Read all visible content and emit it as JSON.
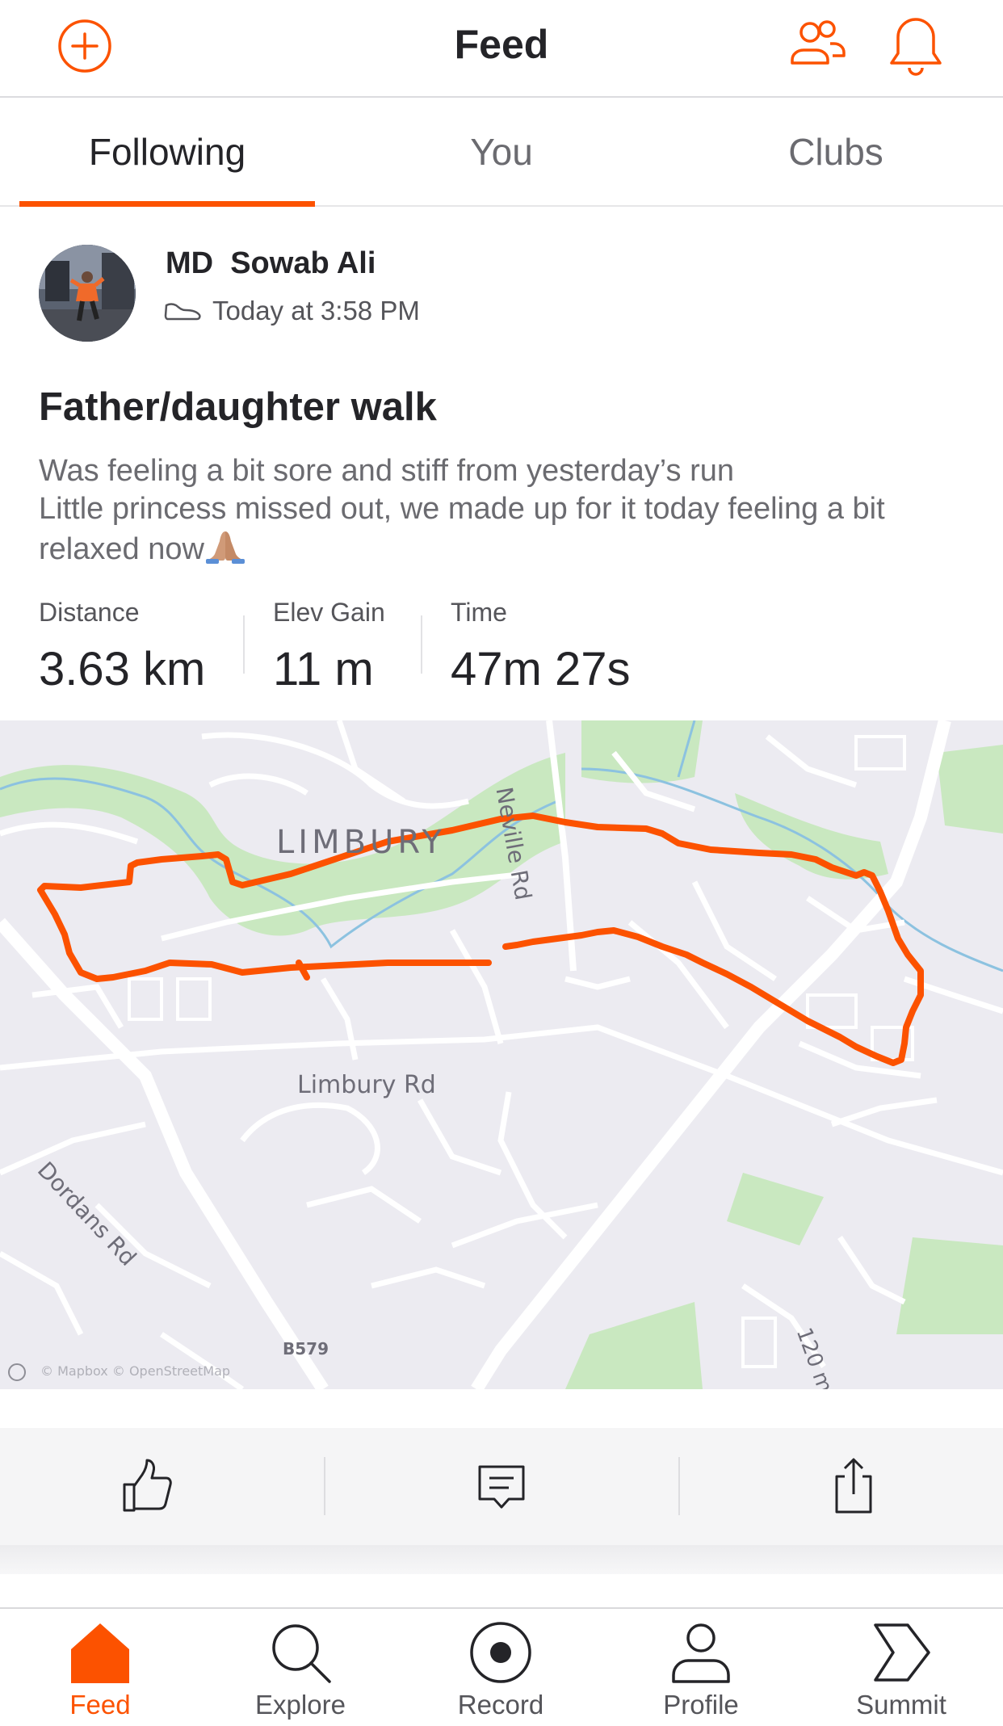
{
  "header": {
    "title": "Feed"
  },
  "tabs": [
    {
      "label": "Following",
      "active": true
    },
    {
      "label": "You",
      "active": false
    },
    {
      "label": "Clubs",
      "active": false
    }
  ],
  "activity": {
    "athlete_name": "MD  Sowab Ali",
    "activity_type_icon": "shoe-icon",
    "timestamp": "Today at 3:58 PM",
    "title": "Father/daughter walk",
    "description_lines": [
      "Was feeling a bit sore and stiff from yesterday’s run",
      "Little princess missed out, we made up for it today feeling a bit",
      "relaxed now"
    ],
    "description_emoji": "praying-hands-icon",
    "stats": [
      {
        "label": "Distance",
        "value": "3.63 km"
      },
      {
        "label": "Elev Gain",
        "value": "11 m"
      },
      {
        "label": "Time",
        "value": "47m 27s"
      }
    ],
    "map": {
      "place_label": "LIMBURY",
      "road_labels": {
        "neville": "Neville Rd",
        "limbury": "Limbury Rd",
        "dordans": "Dordans Rd",
        "b579": "B579",
        "contour": "120 m"
      },
      "attribution": "© Mapbox © OpenStreetMap",
      "route_color": "#fc5200"
    }
  },
  "actions": {
    "kudos_icon": "thumbs-up-icon",
    "comment_icon": "comment-icon",
    "share_icon": "share-icon"
  },
  "bottom_nav": [
    {
      "label": "Feed",
      "icon": "home-icon",
      "active": true
    },
    {
      "label": "Explore",
      "icon": "search-icon",
      "active": false
    },
    {
      "label": "Record",
      "icon": "record-icon",
      "active": false
    },
    {
      "label": "Profile",
      "icon": "profile-icon",
      "active": false
    },
    {
      "label": "Summit",
      "icon": "summit-icon",
      "active": false
    }
  ],
  "colors": {
    "accent": "#fc5200",
    "text_primary": "#242428",
    "text_secondary": "#6b6b70"
  }
}
